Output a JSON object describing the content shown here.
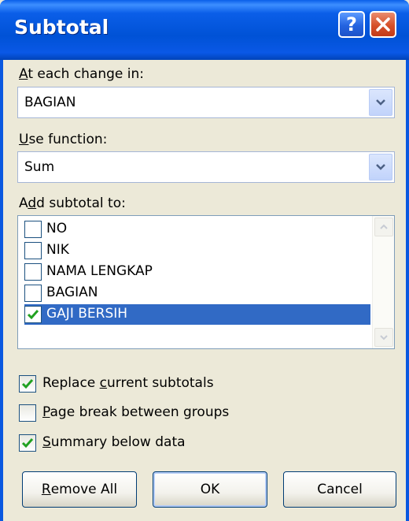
{
  "window": {
    "title": "Subtotal",
    "help_label": "?"
  },
  "at_each_change": {
    "label_prefix": "",
    "label_key": "A",
    "label_rest": "t each change in:",
    "value": "BAGIAN"
  },
  "use_function": {
    "label_key": "U",
    "label_rest": "se function:",
    "value": "Sum"
  },
  "add_subtotal": {
    "label_pre": "A",
    "label_key": "d",
    "label_rest": "d subtotal to:",
    "items": [
      {
        "label": "NO",
        "checked": false,
        "selected": false
      },
      {
        "label": "NIK",
        "checked": false,
        "selected": false
      },
      {
        "label": "NAMA LENGKAP",
        "checked": false,
        "selected": false
      },
      {
        "label": "BAGIAN",
        "checked": false,
        "selected": false
      },
      {
        "label": "GAJI BERSIH",
        "checked": true,
        "selected": true
      }
    ]
  },
  "options": {
    "replace": {
      "pre": "Replace ",
      "key": "c",
      "rest": "urrent subtotals",
      "checked": true
    },
    "page_break": {
      "pre": "",
      "key": "P",
      "rest": "age break between groups",
      "checked": false
    },
    "summary": {
      "pre": "",
      "key": "S",
      "rest": "ummary below data",
      "checked": true
    }
  },
  "buttons": {
    "remove_all": {
      "key": "R",
      "rest": "emove All"
    },
    "ok": "OK",
    "cancel": "Cancel"
  },
  "colors": {
    "titlebar": "#0a58e0",
    "selection": "#316ac5",
    "check": "#21a121",
    "dialog_bg": "#ece9d8"
  }
}
